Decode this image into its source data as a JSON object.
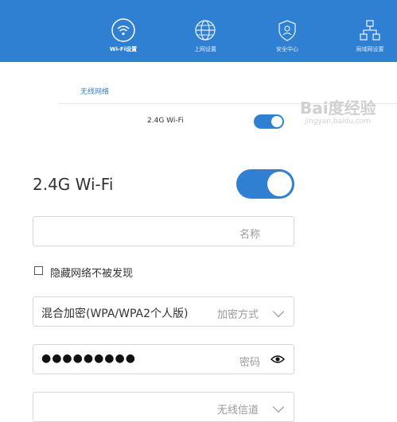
{
  "nav": {
    "items": [
      {
        "label": "Wi-Fi设置",
        "icon": "wifi-icon",
        "active": true
      },
      {
        "label": "上网设置",
        "icon": "globe-icon",
        "active": false
      },
      {
        "label": "安全中心",
        "icon": "shield-icon",
        "active": false
      },
      {
        "label": "局域网设置",
        "icon": "network-icon",
        "active": false
      }
    ]
  },
  "colors": {
    "accent": "#2f7fd3",
    "border": "#d6d6d6",
    "hint": "#9a9a9a"
  },
  "section": {
    "title": "无线网络"
  },
  "summary_row": {
    "label": "2.4G Wi-Fi",
    "toggle_on": true
  },
  "watermark": {
    "main": "Bai度经验",
    "sub": "jingyan.baidu.com"
  },
  "wifi": {
    "label": "2.4G Wi-Fi",
    "toggle_on": true,
    "name_field": {
      "value": "",
      "hint": "名称"
    },
    "hide_checkbox": {
      "label": "隐藏网络不被发现",
      "checked": false
    },
    "encryption": {
      "value": "混合加密(WPA/WPA2个人版)",
      "hint": "加密方式"
    },
    "password": {
      "masked": "●●●●●●●●●",
      "hint": "密码"
    },
    "channel": {
      "value": "",
      "hint": "无线信道"
    }
  }
}
